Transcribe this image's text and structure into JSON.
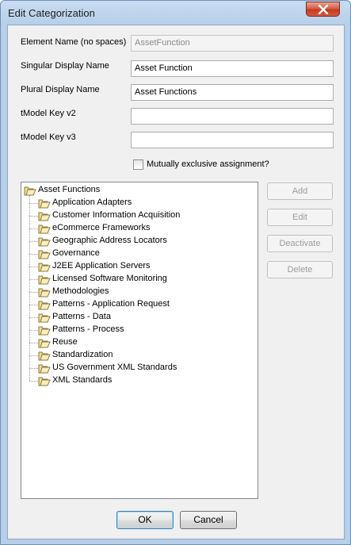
{
  "window": {
    "title": "Edit Categorization"
  },
  "form": {
    "element_name_label": "Element Name (no spaces)",
    "element_name_value": "AssetFunction",
    "singular_label": "Singular Display Name",
    "singular_value": "Asset Function",
    "plural_label": "Plural Display Name",
    "plural_value": "Asset Functions",
    "tmodel_v2_label": "tModel Key v2",
    "tmodel_v2_value": "",
    "tmodel_v3_label": "tModel Key v3",
    "tmodel_v3_value": "",
    "mutually_exclusive_label": "Mutually exclusive assignment?",
    "mutually_exclusive_checked": false
  },
  "tree": {
    "root": "Asset Functions",
    "items": [
      "Application Adapters",
      "Customer Information Acquisition",
      "eCommerce Frameworks",
      "Geographic Address Locators",
      "Governance",
      "J2EE Application Servers",
      "Licensed Software Monitoring",
      "Methodologies",
      "Patterns - Application Request",
      "Patterns - Data",
      "Patterns - Process",
      "Reuse",
      "Standardization",
      "US Government XML Standards",
      "XML Standards"
    ]
  },
  "side_buttons": {
    "add": "Add",
    "edit": "Edit",
    "deactivate": "Deactivate",
    "delete": "Delete"
  },
  "footer": {
    "ok": "OK",
    "cancel": "Cancel"
  },
  "icons": {
    "folder": "folder-icon",
    "close": "close-icon"
  },
  "colors": {
    "title_bar": "#b7cfe9",
    "close_button": "#c94a2e",
    "folder": "#f2d98c"
  }
}
